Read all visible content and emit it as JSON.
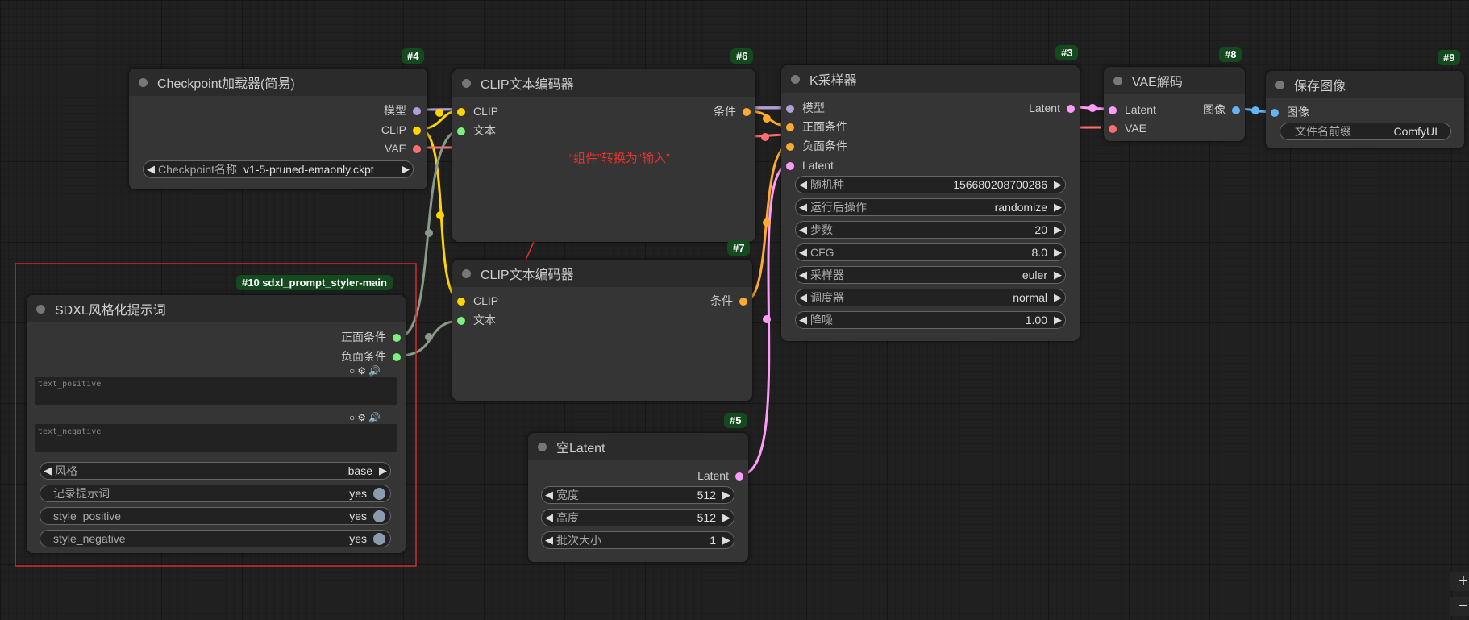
{
  "colors": {
    "model": "#b39ddb",
    "clip": "#ffd500",
    "vae": "#ff6e6e",
    "conditioning": "#ffa931",
    "latent": "#ff9cf9",
    "image": "#64b5f6",
    "string": "#7cf07c",
    "annotation": "#e8322d",
    "badge_bg": "#154a1f"
  },
  "nodes": {
    "checkpoint": {
      "badge": "#4",
      "title": "Checkpoint加载器(简易)",
      "outputs": [
        "模型",
        "CLIP",
        "VAE"
      ],
      "widget_label": "Checkpoint名称",
      "widget_value": "v1-5-pruned-emaonly.ckpt"
    },
    "clip1": {
      "badge": "#6",
      "title": "CLIP文本编码器",
      "inputs": [
        "CLIP",
        "文本"
      ],
      "output": "条件"
    },
    "clip2": {
      "badge": "#7",
      "title": "CLIP文本编码器",
      "inputs": [
        "CLIP",
        "文本"
      ],
      "output": "条件"
    },
    "ksampler": {
      "badge": "#3",
      "title": "K采样器",
      "inputs": [
        "模型",
        "正面条件",
        "负面条件",
        "Latent"
      ],
      "output": "Latent",
      "widgets": [
        {
          "label": "随机种",
          "value": "156680208700286"
        },
        {
          "label": "运行后操作",
          "value": "randomize"
        },
        {
          "label": "步数",
          "value": "20"
        },
        {
          "label": "CFG",
          "value": "8.0"
        },
        {
          "label": "采样器",
          "value": "euler"
        },
        {
          "label": "调度器",
          "value": "normal"
        },
        {
          "label": "降噪",
          "value": "1.00"
        }
      ]
    },
    "vae_decode": {
      "badge": "#8",
      "title": "VAE解码",
      "inputs": [
        "Latent",
        "VAE"
      ],
      "output": "图像"
    },
    "save_image": {
      "badge": "#9",
      "title": "保存图像",
      "input": "图像",
      "widget_label": "文件名前缀",
      "widget_value": "ComfyUI"
    },
    "empty_latent": {
      "badge": "#5",
      "title": "空Latent",
      "output": "Latent",
      "widgets": [
        {
          "label": "宽度",
          "value": "512"
        },
        {
          "label": "高度",
          "value": "512"
        },
        {
          "label": "批次大小",
          "value": "1"
        }
      ]
    },
    "styler": {
      "badge": "#10 sdxl_prompt_styler-main",
      "title": "SDXL风格化提示词",
      "outputs": [
        "正面条件",
        "负面条件"
      ],
      "text_positive_placeholder": "text_positive",
      "text_negative_placeholder": "text_negative",
      "combo": {
        "label": "风格",
        "value": "base"
      },
      "toggles": [
        {
          "label": "记录提示词",
          "value": "yes"
        },
        {
          "label": "style_positive",
          "value": "yes"
        },
        {
          "label": "style_negative",
          "value": "yes"
        }
      ]
    }
  },
  "annotation": {
    "text": "“组件”转换为“输入”"
  },
  "zoom": {
    "plus": "+",
    "minus": "−"
  }
}
